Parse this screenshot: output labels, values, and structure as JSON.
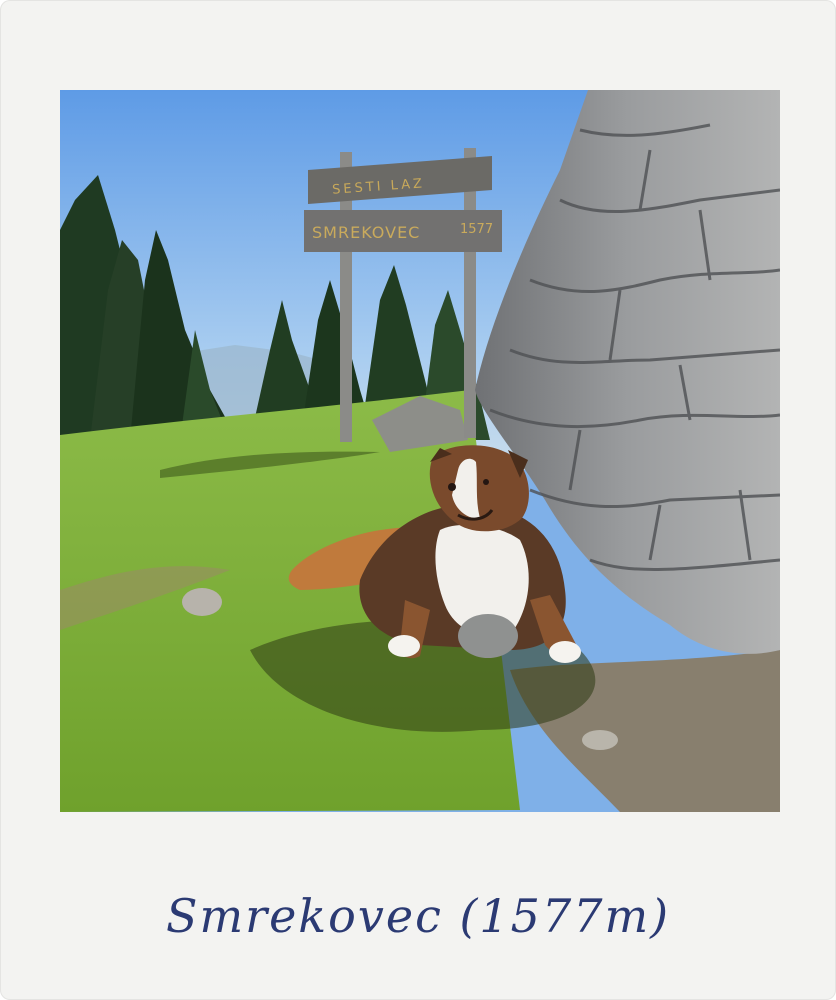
{
  "caption": "Smrekovec (1577m)",
  "sign": {
    "top_board": "SESTI LAZ",
    "top_board_sub": "",
    "main_board": "SMREKOVEC",
    "main_board_number": "1577"
  },
  "colors": {
    "frame": "#f3f3f1",
    "sky_top": "#5e9be6",
    "sky_bottom": "#b9d6f0",
    "grass": "#7fb13a",
    "stone": "#8f9295",
    "ink": "#2b3a73"
  }
}
